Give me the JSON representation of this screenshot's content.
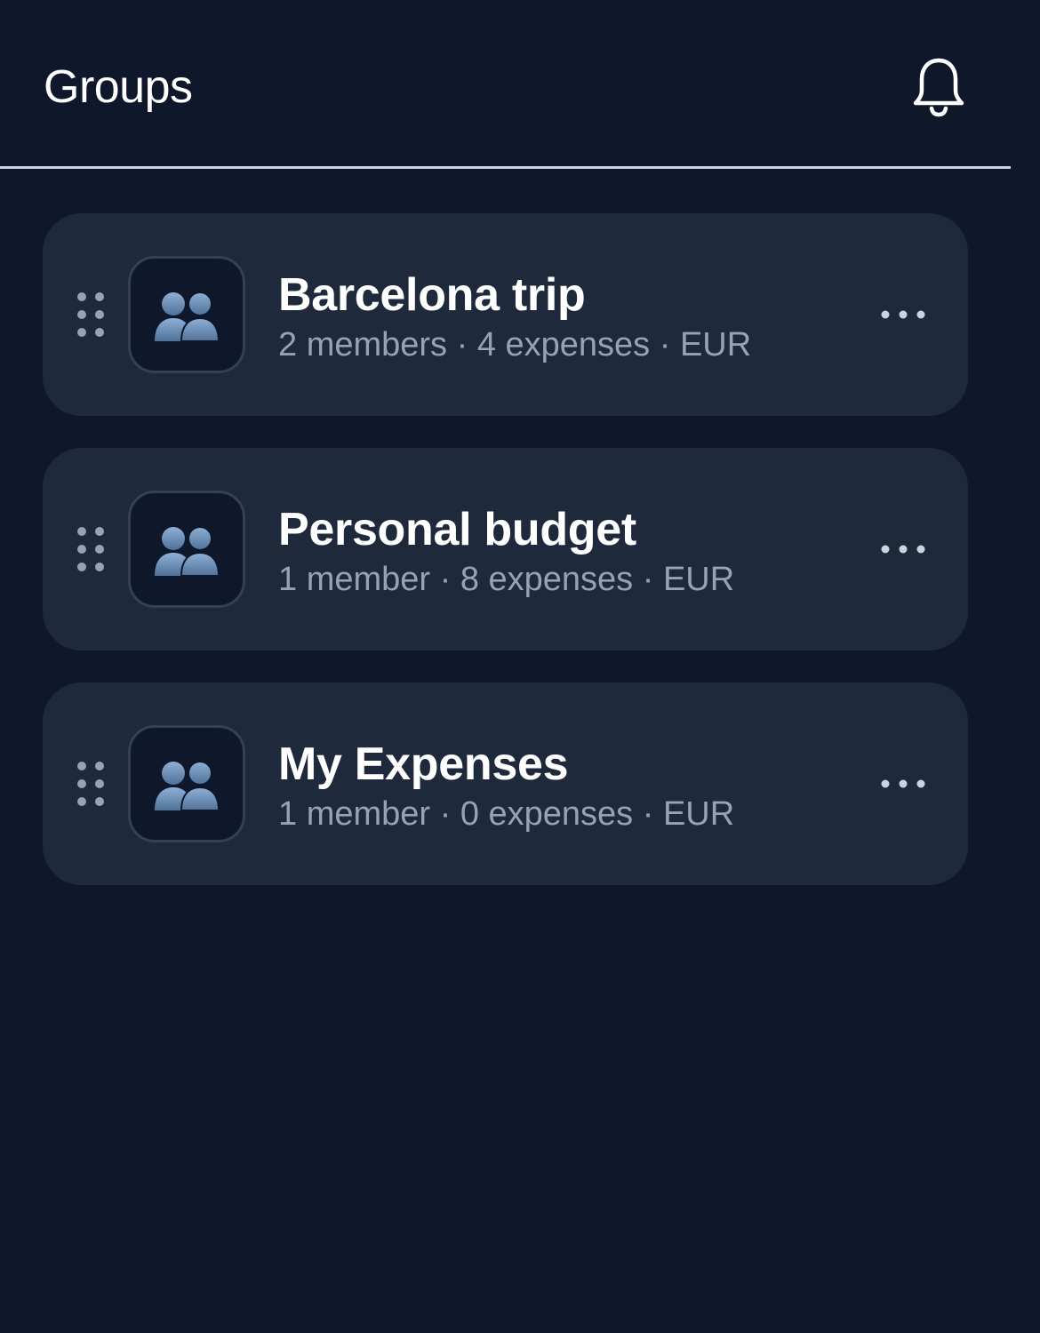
{
  "header": {
    "title": "Groups",
    "notification_icon": "bell-icon"
  },
  "groups": [
    {
      "name": "Barcelona trip",
      "members": "2 members",
      "expenses": "4 expenses",
      "currency": "EUR",
      "meta": "2 members · 4 expenses · EUR",
      "icon": "people-icon"
    },
    {
      "name": "Personal budget",
      "members": "1 member",
      "expenses": "8 expenses",
      "currency": "EUR",
      "meta": "1 member · 8 expenses · EUR",
      "icon": "people-icon"
    },
    {
      "name": "My Expenses",
      "members": "1 member",
      "expenses": "0 expenses",
      "currency": "EUR",
      "meta": "1 member · 0 expenses · EUR",
      "icon": "people-icon"
    }
  ],
  "colors": {
    "background": "#0f172a",
    "card": "#1e293b",
    "text_primary": "#ffffff",
    "text_secondary": "#94a3b8",
    "divider": "#cbd5e1",
    "icon_blue": "#6b8fb8"
  }
}
